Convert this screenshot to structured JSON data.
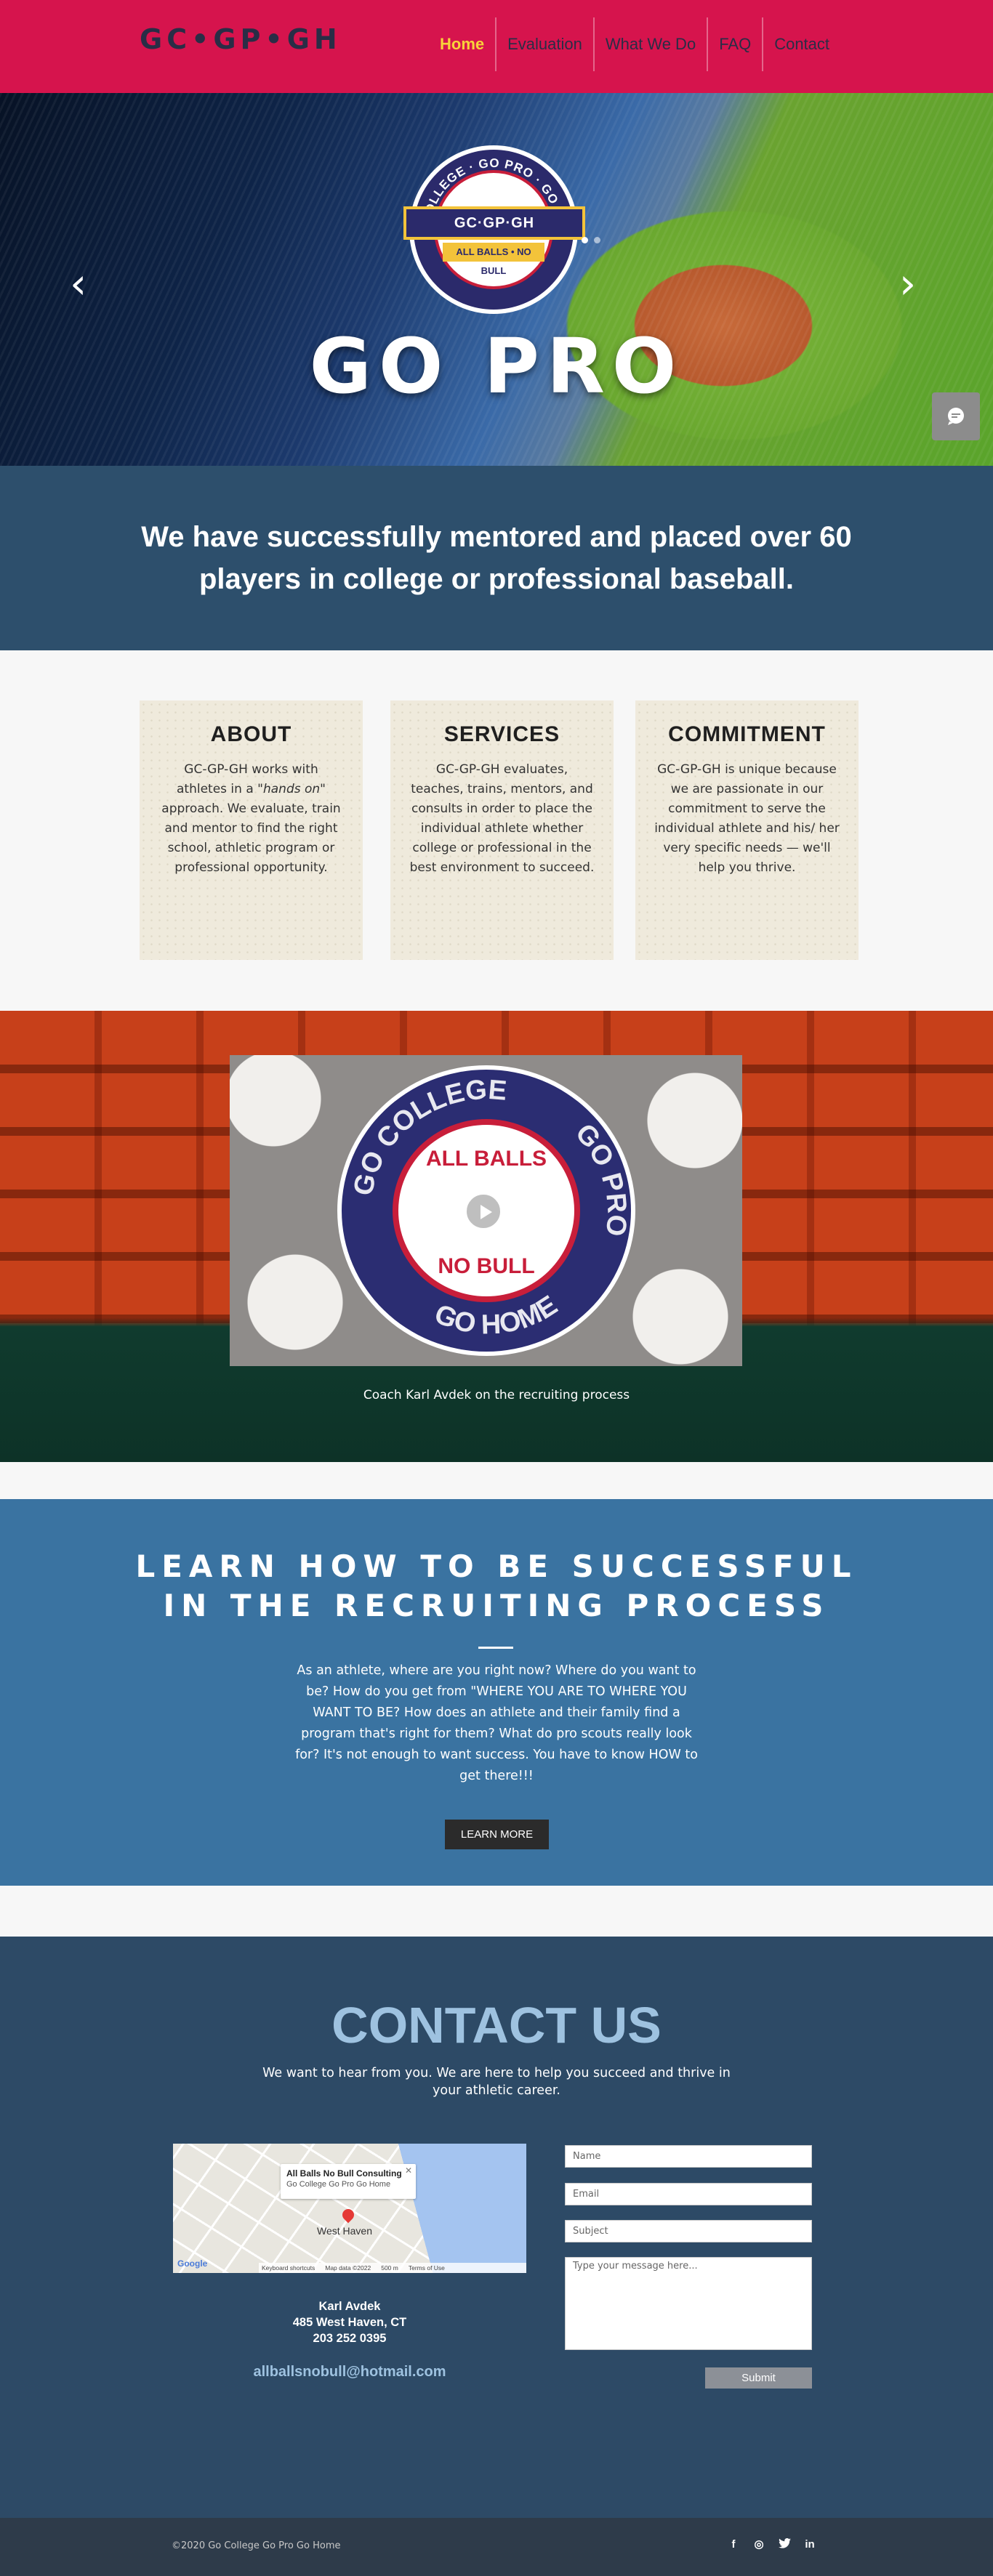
{
  "header": {
    "logo": "GC•GP•GH",
    "nav": [
      {
        "label": "Home",
        "active": true
      },
      {
        "label": "Evaluation"
      },
      {
        "label": "What We Do"
      },
      {
        "label": "FAQ"
      },
      {
        "label": "Contact"
      }
    ],
    "brand_color": "#d6144d",
    "active_color": "#f8d23a"
  },
  "hero": {
    "title": "GO PRO",
    "emblem": {
      "ring": "GO COLLEGE · GO PRO · GO HOME",
      "banner": "GC·GP·GH",
      "subbanner": "ALL BALLS • NO BULL"
    },
    "prev_icon": "chevron-left-icon",
    "next_icon": "chevron-right-icon",
    "slide_count": 2,
    "active_slide": 1,
    "chat_icon": "chat-icon"
  },
  "mentor": {
    "text": "We have successfully mentored and placed over 60 players in college or professional baseball."
  },
  "cards": [
    {
      "title": "ABOUT",
      "text_before": "GC-GP-GH works with athletes in a ",
      "text_em": "\"hands on\"",
      "text_after": " approach.  We evaluate, train and mentor to find the right school, athletic program or professional opportunity."
    },
    {
      "title": "SERVICES",
      "text_before": "GC-GP-GH evaluates, teaches, trains, mentors, and consults in order to place the individual athlete whether college or professional in the best environment to succeed.",
      "text_em": "",
      "text_after": ""
    },
    {
      "title": "COMMITMENT",
      "text_before": "GC-GP-GH is unique because we are passionate in our commitment to serve the individual athlete and his/ her very specific needs — we'll help you thrive.",
      "text_em": "",
      "text_after": ""
    }
  ],
  "video": {
    "badge_top": "GO COLLEGE",
    "badge_right": "GO PRO",
    "badge_bottom": "GO HOME",
    "inner_top": "ALL BALLS",
    "inner_bottom": "NO BULL",
    "play_icon": "play-icon",
    "caption": "Coach Karl Avdek on the recruiting process"
  },
  "learn": {
    "title_line1": "LEARN HOW TO BE SUCCESSFUL",
    "title_line2": "IN THE RECRUITING PROCESS",
    "text": "As an athlete, where are you right now?  Where do you want to be?  How do you get from \"WHERE YOU ARE TO WHERE YOU WANT TO BE?  How does an athlete and their family find a program that's right for them?  What do pro scouts really look for?  It's not enough to want success.  You have to know HOW to get there!!!",
    "button": "LEARN MORE"
  },
  "contact": {
    "title": "CONTACT US",
    "subtitle": "We want to hear from you.  We are here to help you succeed and thrive in your athletic career.",
    "map": {
      "card_title": "All Balls No Bull Consulting",
      "card_sub": "Go College Go Pro Go Home",
      "place": "West Haven",
      "google": "Google",
      "footer_items": [
        "Keyboard shortcuts",
        "Map data ©2022",
        "500 m",
        "Terms of Use"
      ]
    },
    "name": "Karl Avdek",
    "address": "485 West Haven, CT",
    "phone": "203 252 0395",
    "email": "allballsnobull@hotmail.com",
    "form": {
      "name_placeholder": "Name",
      "email_placeholder": "Email",
      "subject_placeholder": "Subject",
      "message_placeholder": "Type your message here...",
      "submit": "Submit"
    }
  },
  "footer": {
    "copyright": "©2020  Go College Go Pro Go Home",
    "social": [
      {
        "icon": "facebook-icon",
        "glyph": "f"
      },
      {
        "icon": "instagram-icon",
        "glyph": "◎"
      },
      {
        "icon": "twitter-icon",
        "glyph": "🐦"
      },
      {
        "icon": "linkedin-icon",
        "glyph": "in"
      }
    ]
  }
}
